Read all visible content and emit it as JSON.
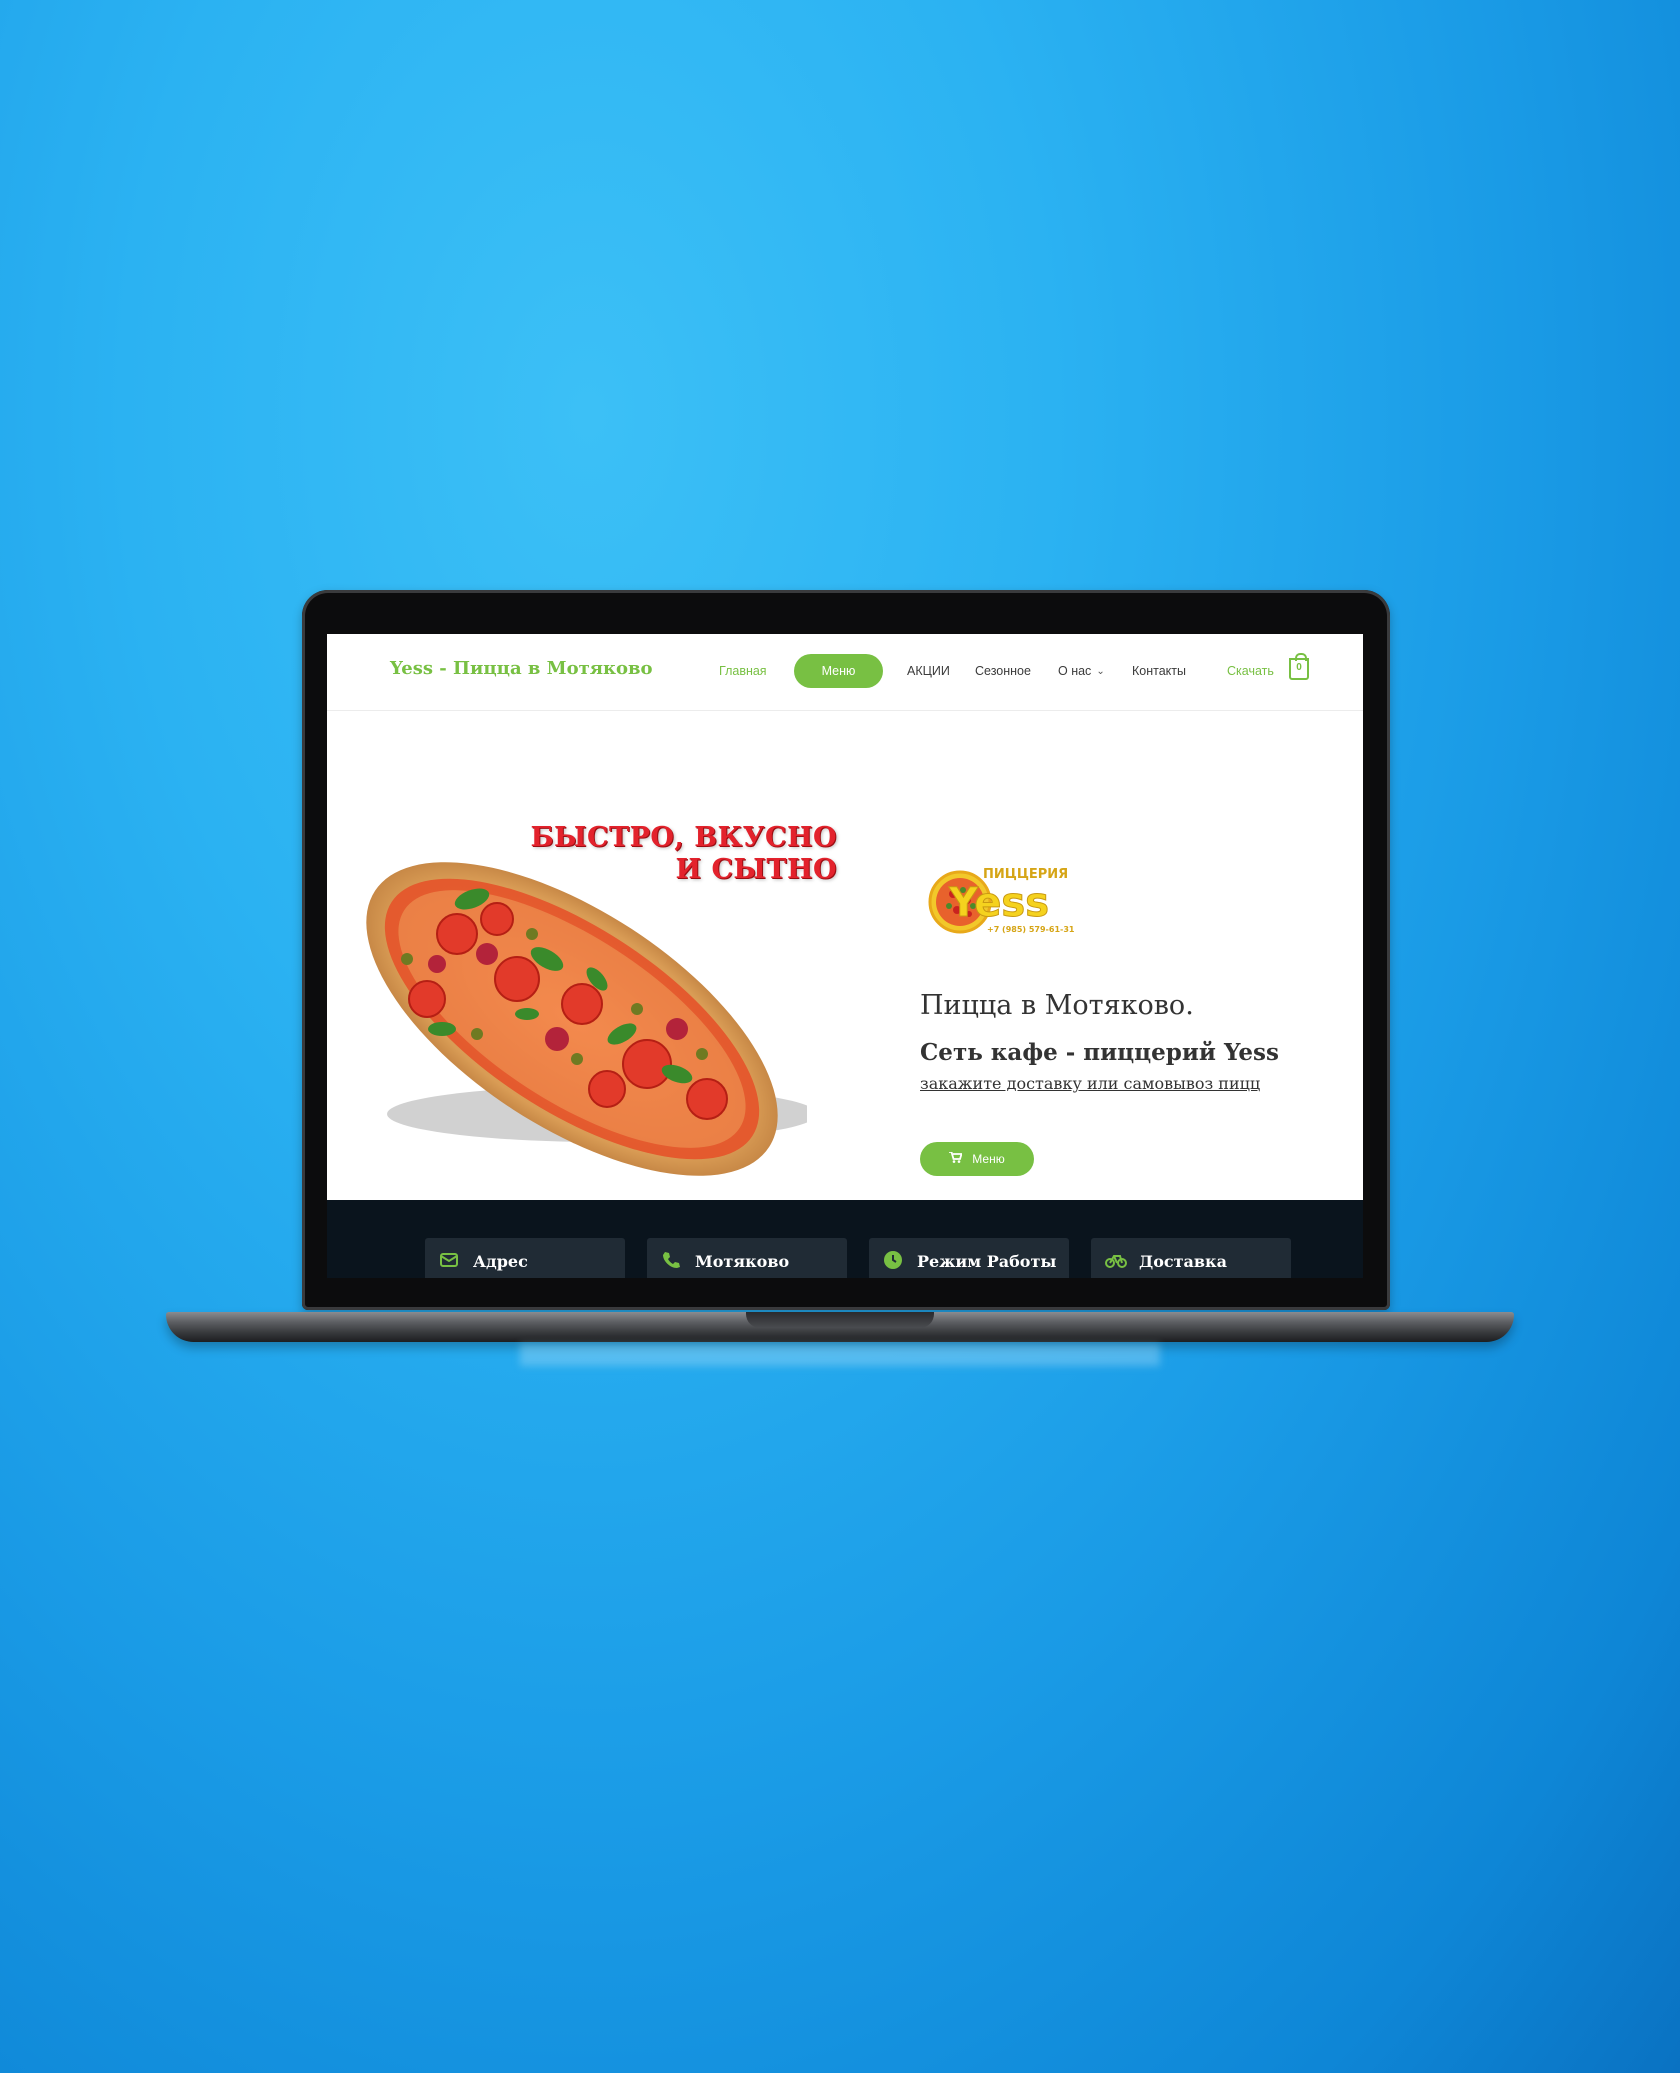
{
  "site": {
    "title": "Yess - Пицца в Мотяково"
  },
  "nav": {
    "items": [
      {
        "label": "Главная"
      },
      {
        "label": "Меню"
      },
      {
        "label": "АКЦИИ"
      },
      {
        "label": "Сезонное"
      },
      {
        "label": "О нас"
      },
      {
        "label": "Контакты"
      }
    ],
    "download_label": "Скачать",
    "cart_count": "0"
  },
  "hero": {
    "slogan_line1": "БЫСТРО, ВКУСНО",
    "slogan_line2": "И СЫТНО",
    "logo_small": "ПИЦЦЕРИЯ",
    "logo_big": "Yess",
    "logo_phone": "+7 (985) 579-61-31",
    "heading": "Пицца в Мотяково.",
    "subheading": "Сеть кафе - пиццерий Yess",
    "link": "закажите доставку или самовывоз пицц",
    "button_label": "Меню"
  },
  "info_bar": {
    "cards": [
      {
        "label": "Адрес",
        "icon": "envelope-icon"
      },
      {
        "label": "Мотяково",
        "icon": "phone-icon"
      },
      {
        "label": "Режим Работы",
        "icon": "clock-icon"
      },
      {
        "label": "Доставка",
        "icon": "bicycle-icon"
      }
    ]
  },
  "colors": {
    "accent": "#78c043",
    "dark_bar": "#0a141d",
    "card": "#202b35",
    "slogan_red": "#e3222c",
    "background": "#1fa6ee"
  }
}
